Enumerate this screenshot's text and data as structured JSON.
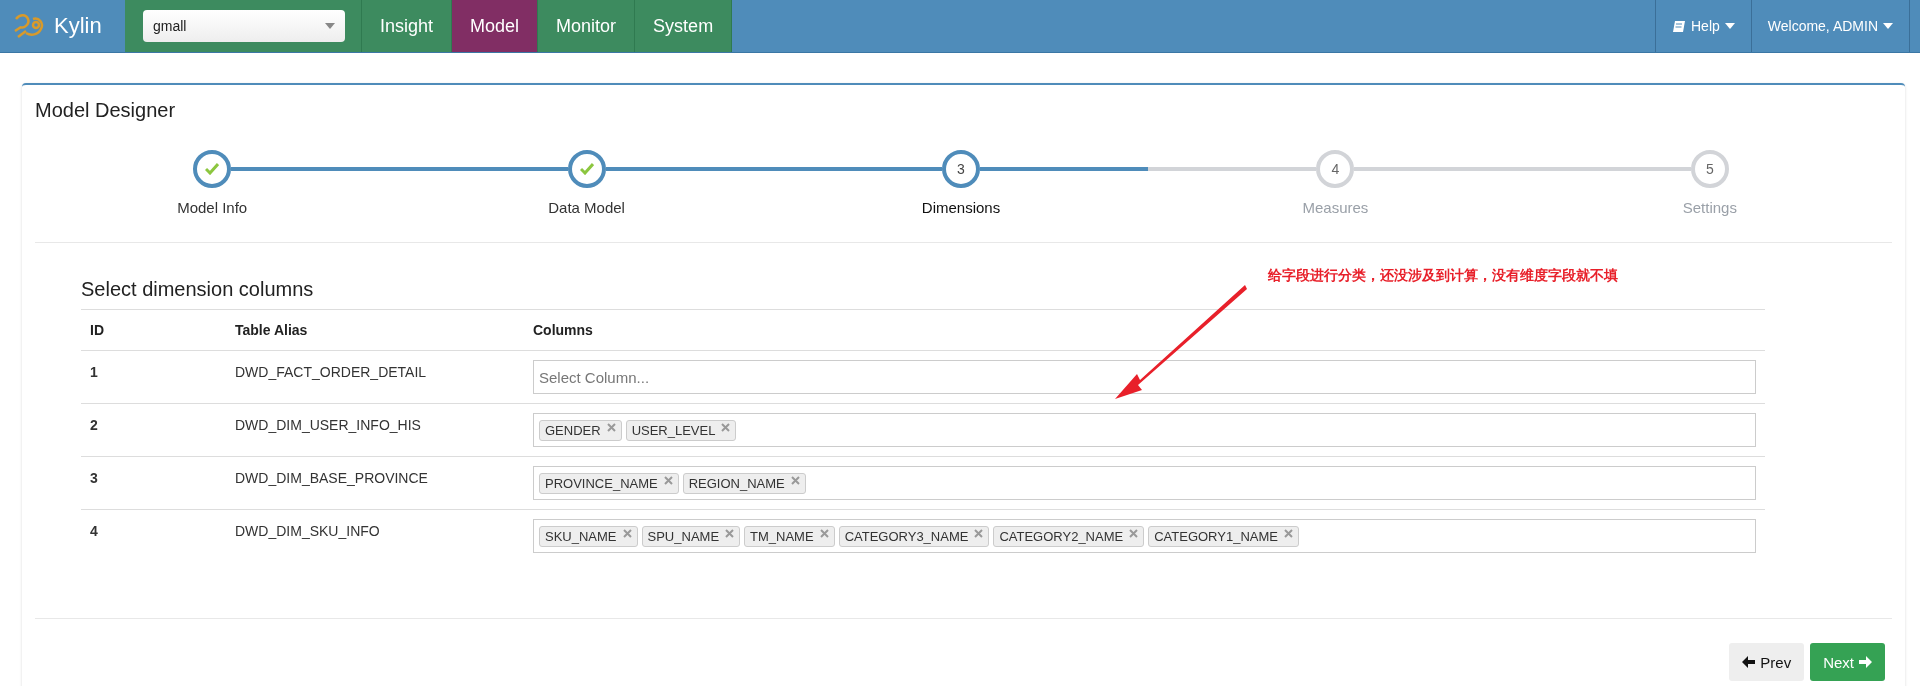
{
  "navbar": {
    "brand": "Kylin",
    "project": "gmall",
    "tabs": [
      {
        "label": "Insight",
        "selected": false
      },
      {
        "label": "Model",
        "selected": true
      },
      {
        "label": "Monitor",
        "selected": false
      },
      {
        "label": "System",
        "selected": false
      }
    ],
    "help": "Help",
    "user": "Welcome, ADMIN"
  },
  "panel": {
    "title": "Model Designer",
    "steps": [
      {
        "label": "Model Info",
        "completed": true,
        "active": false
      },
      {
        "label": "Data Model",
        "completed": true,
        "active": false
      },
      {
        "number": "3",
        "label": "Dimensions",
        "completed": false,
        "active": true
      },
      {
        "number": "4",
        "label": "Measures",
        "completed": false,
        "active": false
      },
      {
        "number": "5",
        "label": "Settings",
        "completed": false,
        "active": false
      }
    ],
    "section_title": "Select dimension columns",
    "table": {
      "columns": [
        "ID",
        "Table Alias",
        "Columns"
      ],
      "rows": [
        {
          "number": "1",
          "alias": "DWD_FACT_ORDER_DETAIL",
          "placeholder": "Select Column...",
          "tags": []
        },
        {
          "number": "2",
          "alias": "DWD_DIM_USER_INFO_HIS",
          "tags": [
            "GENDER",
            "USER_LEVEL"
          ]
        },
        {
          "number": "3",
          "alias": "DWD_DIM_BASE_PROVINCE",
          "tags": [
            "PROVINCE_NAME",
            "REGION_NAME"
          ]
        },
        {
          "number": "4",
          "alias": "DWD_DIM_SKU_INFO",
          "tags": [
            "SKU_NAME",
            "SPU_NAME",
            "TM_NAME",
            "CATEGORY3_NAME",
            "CATEGORY2_NAME",
            "CATEGORY1_NAME"
          ]
        }
      ]
    },
    "prev": "Prev",
    "next": "Next"
  },
  "annotation": {
    "text": "给字段进行分类，还没涉及到计算，没有维度字段就不填"
  }
}
